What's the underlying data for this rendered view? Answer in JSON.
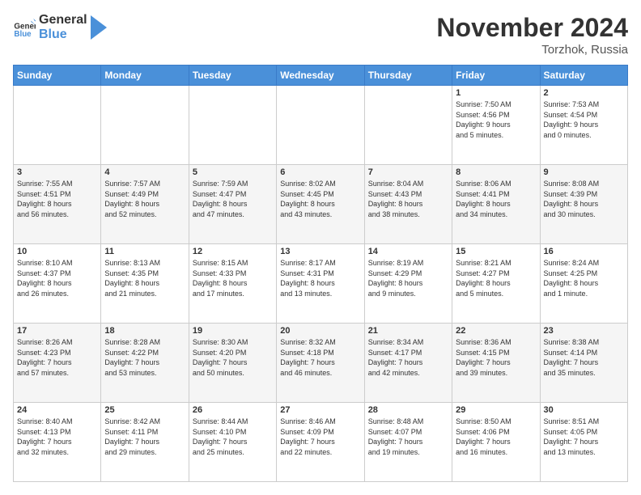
{
  "header": {
    "logo_general": "General",
    "logo_blue": "Blue",
    "month_title": "November 2024",
    "location": "Torzhok, Russia"
  },
  "calendar": {
    "days_of_week": [
      "Sunday",
      "Monday",
      "Tuesday",
      "Wednesday",
      "Thursday",
      "Friday",
      "Saturday"
    ],
    "weeks": [
      [
        {
          "day": "",
          "info": ""
        },
        {
          "day": "",
          "info": ""
        },
        {
          "day": "",
          "info": ""
        },
        {
          "day": "",
          "info": ""
        },
        {
          "day": "",
          "info": ""
        },
        {
          "day": "1",
          "info": "Sunrise: 7:50 AM\nSunset: 4:56 PM\nDaylight: 9 hours\nand 5 minutes."
        },
        {
          "day": "2",
          "info": "Sunrise: 7:53 AM\nSunset: 4:54 PM\nDaylight: 9 hours\nand 0 minutes."
        }
      ],
      [
        {
          "day": "3",
          "info": "Sunrise: 7:55 AM\nSunset: 4:51 PM\nDaylight: 8 hours\nand 56 minutes."
        },
        {
          "day": "4",
          "info": "Sunrise: 7:57 AM\nSunset: 4:49 PM\nDaylight: 8 hours\nand 52 minutes."
        },
        {
          "day": "5",
          "info": "Sunrise: 7:59 AM\nSunset: 4:47 PM\nDaylight: 8 hours\nand 47 minutes."
        },
        {
          "day": "6",
          "info": "Sunrise: 8:02 AM\nSunset: 4:45 PM\nDaylight: 8 hours\nand 43 minutes."
        },
        {
          "day": "7",
          "info": "Sunrise: 8:04 AM\nSunset: 4:43 PM\nDaylight: 8 hours\nand 38 minutes."
        },
        {
          "day": "8",
          "info": "Sunrise: 8:06 AM\nSunset: 4:41 PM\nDaylight: 8 hours\nand 34 minutes."
        },
        {
          "day": "9",
          "info": "Sunrise: 8:08 AM\nSunset: 4:39 PM\nDaylight: 8 hours\nand 30 minutes."
        }
      ],
      [
        {
          "day": "10",
          "info": "Sunrise: 8:10 AM\nSunset: 4:37 PM\nDaylight: 8 hours\nand 26 minutes."
        },
        {
          "day": "11",
          "info": "Sunrise: 8:13 AM\nSunset: 4:35 PM\nDaylight: 8 hours\nand 21 minutes."
        },
        {
          "day": "12",
          "info": "Sunrise: 8:15 AM\nSunset: 4:33 PM\nDaylight: 8 hours\nand 17 minutes."
        },
        {
          "day": "13",
          "info": "Sunrise: 8:17 AM\nSunset: 4:31 PM\nDaylight: 8 hours\nand 13 minutes."
        },
        {
          "day": "14",
          "info": "Sunrise: 8:19 AM\nSunset: 4:29 PM\nDaylight: 8 hours\nand 9 minutes."
        },
        {
          "day": "15",
          "info": "Sunrise: 8:21 AM\nSunset: 4:27 PM\nDaylight: 8 hours\nand 5 minutes."
        },
        {
          "day": "16",
          "info": "Sunrise: 8:24 AM\nSunset: 4:25 PM\nDaylight: 8 hours\nand 1 minute."
        }
      ],
      [
        {
          "day": "17",
          "info": "Sunrise: 8:26 AM\nSunset: 4:23 PM\nDaylight: 7 hours\nand 57 minutes."
        },
        {
          "day": "18",
          "info": "Sunrise: 8:28 AM\nSunset: 4:22 PM\nDaylight: 7 hours\nand 53 minutes."
        },
        {
          "day": "19",
          "info": "Sunrise: 8:30 AM\nSunset: 4:20 PM\nDaylight: 7 hours\nand 50 minutes."
        },
        {
          "day": "20",
          "info": "Sunrise: 8:32 AM\nSunset: 4:18 PM\nDaylight: 7 hours\nand 46 minutes."
        },
        {
          "day": "21",
          "info": "Sunrise: 8:34 AM\nSunset: 4:17 PM\nDaylight: 7 hours\nand 42 minutes."
        },
        {
          "day": "22",
          "info": "Sunrise: 8:36 AM\nSunset: 4:15 PM\nDaylight: 7 hours\nand 39 minutes."
        },
        {
          "day": "23",
          "info": "Sunrise: 8:38 AM\nSunset: 4:14 PM\nDaylight: 7 hours\nand 35 minutes."
        }
      ],
      [
        {
          "day": "24",
          "info": "Sunrise: 8:40 AM\nSunset: 4:13 PM\nDaylight: 7 hours\nand 32 minutes."
        },
        {
          "day": "25",
          "info": "Sunrise: 8:42 AM\nSunset: 4:11 PM\nDaylight: 7 hours\nand 29 minutes."
        },
        {
          "day": "26",
          "info": "Sunrise: 8:44 AM\nSunset: 4:10 PM\nDaylight: 7 hours\nand 25 minutes."
        },
        {
          "day": "27",
          "info": "Sunrise: 8:46 AM\nSunset: 4:09 PM\nDaylight: 7 hours\nand 22 minutes."
        },
        {
          "day": "28",
          "info": "Sunrise: 8:48 AM\nSunset: 4:07 PM\nDaylight: 7 hours\nand 19 minutes."
        },
        {
          "day": "29",
          "info": "Sunrise: 8:50 AM\nSunset: 4:06 PM\nDaylight: 7 hours\nand 16 minutes."
        },
        {
          "day": "30",
          "info": "Sunrise: 8:51 AM\nSunset: 4:05 PM\nDaylight: 7 hours\nand 13 minutes."
        }
      ]
    ]
  }
}
